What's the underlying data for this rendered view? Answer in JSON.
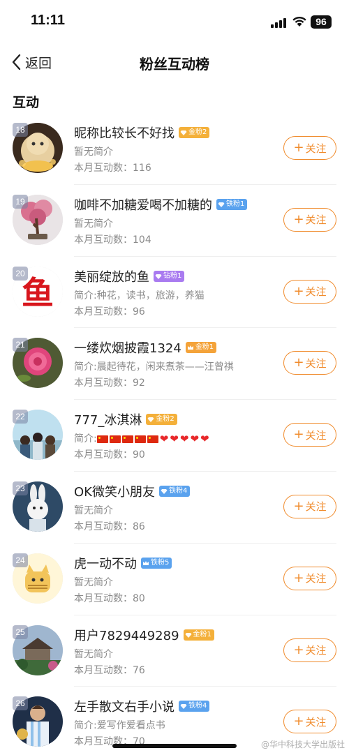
{
  "status_bar": {
    "time": "11:11",
    "battery": "96"
  },
  "nav": {
    "back_label": "返回",
    "title": "粉丝互动榜"
  },
  "section_title": "互动",
  "follow_label": "关注",
  "watermark": "@华中科技大学出版社",
  "colors": {
    "accent": "#f08b2c",
    "gold_badge": "#f4b03a",
    "iron_badge": "#5aa2ee",
    "diamond_badge": "#a97bf0"
  },
  "fans": [
    {
      "rank": "18",
      "name": "昵称比较长不好找",
      "badge": "金粉2",
      "badge_type": "gold",
      "intro": "暂无简介",
      "count_label": "本月互动数：116",
      "avatar": "knit-doll"
    },
    {
      "rank": "19",
      "name": "咖啡不加糖爱喝不加糖的",
      "badge": "铁粉1",
      "badge_type": "iron",
      "intro": "暂无简介",
      "count_label": "本月互动数：104",
      "avatar": "plum-bonsai"
    },
    {
      "rank": "20",
      "name": "美丽绽放的鱼",
      "badge": "钻粉1",
      "badge_type": "diamond",
      "intro": "简介:种花，读书，旅游，养猫",
      "count_label": "本月互动数：96",
      "avatar": "red-fish-character"
    },
    {
      "rank": "21",
      "name": "一缕炊烟披霞1324",
      "badge": "金粉1",
      "badge_type": "gold-crown",
      "intro": "简介:晨起待花，闲来煮茶——汪曾祺",
      "count_label": "本月互动数：92",
      "avatar": "pink-rose"
    },
    {
      "rank": "22",
      "name": "777_冰淇淋",
      "badge": "金粉2",
      "badge_type": "gold",
      "intro_prefix": "简介:",
      "intro_emoji": {
        "flags": 5,
        "hearts": 5
      },
      "count_label": "本月互动数：90",
      "avatar": "crowd-sky"
    },
    {
      "rank": "23",
      "name": "OK微笑小朋友",
      "badge": "铁粉4",
      "badge_type": "iron",
      "intro": "暂无简介",
      "count_label": "本月互动数：86",
      "avatar": "white-rabbit"
    },
    {
      "rank": "24",
      "name": "虎一动不动",
      "badge": "铁粉5",
      "badge_type": "iron-crown",
      "intro": "暂无简介",
      "count_label": "本月互动数：80",
      "avatar": "cartoon-cat"
    },
    {
      "rank": "25",
      "name": "用户7829449289",
      "badge": "金粉1",
      "badge_type": "gold",
      "intro": "暂无简介",
      "count_label": "本月互动数：76",
      "avatar": "garden-house"
    },
    {
      "rank": "26",
      "name": "左手散文右手小说",
      "badge": "铁粉4",
      "badge_type": "iron",
      "intro": "简介:爱写作爱看点书",
      "count_label": "本月互动数：70",
      "avatar": "football-player"
    }
  ]
}
